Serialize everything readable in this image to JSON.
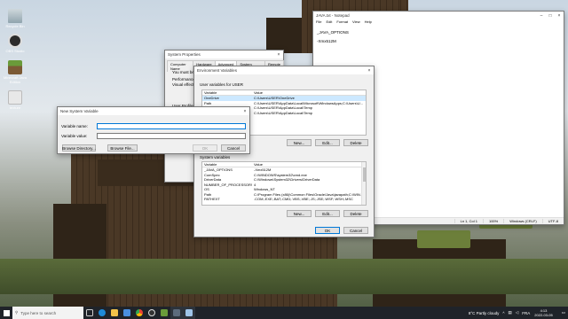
{
  "desktop": {
    "icons": [
      {
        "label": "Recycle Bin",
        "name": "recycle-bin-icon"
      },
      {
        "label": "OBS Studio",
        "name": "obs-studio-icon"
      },
      {
        "label": "Minecraft Java Edition",
        "name": "minecraft-icon"
      },
      {
        "label": "texture",
        "name": "folder-icon"
      }
    ]
  },
  "notepad": {
    "title": "JAVA.txt - Notepad",
    "menu": [
      "File",
      "Edit",
      "Format",
      "View",
      "Help"
    ],
    "lines": [
      "_JAVA_OPTIONS",
      "-Xmx512M"
    ],
    "status": {
      "position": "Ln 1, Col 1",
      "zoom": "100%",
      "eol": "Windows (CRLF)",
      "encoding": "UTF-8"
    }
  },
  "sysprops": {
    "title": "System Properties",
    "tabs": [
      "Computer Name",
      "Hardware",
      "Advanced",
      "System Protection",
      "Remote"
    ],
    "text1": "You must be lo",
    "text2": "Performance",
    "text3": "Visual effects",
    "text4": "User Profiles"
  },
  "envvars": {
    "title": "Environment Variables",
    "user_section": "User variables for USER",
    "system_section": "System variables",
    "col_variable": "Variable",
    "col_value": "Value",
    "user_rows": [
      {
        "variable": "OneDrive",
        "value": "C:\\Users\\USER\\OneDrive"
      },
      {
        "variable": "Path",
        "value": "C:\\Users\\USER\\AppData\\Local\\Microsoft\\WindowsApps;C:\\Users\\U..."
      },
      {
        "variable": "TEMP",
        "value": "C:\\Users\\USER\\AppData\\Local\\Temp"
      },
      {
        "variable": "TMP",
        "value": "C:\\Users\\USER\\AppData\\Local\\Temp"
      }
    ],
    "system_rows": [
      {
        "variable": "_JAVA_OPTIONS",
        "value": "-Xmx512M"
      },
      {
        "variable": "ComSpec",
        "value": "C:\\WINDOWS\\system32\\cmd.exe"
      },
      {
        "variable": "DriverData",
        "value": "C:\\Windows\\System32\\Drivers\\DriverData"
      },
      {
        "variable": "NUMBER_OF_PROCESSORS",
        "value": "4"
      },
      {
        "variable": "OS",
        "value": "Windows_NT"
      },
      {
        "variable": "Path",
        "value": "C:\\Program Files (x86)\\Common Files\\Oracle\\Java\\javapath;C:\\WIN..."
      },
      {
        "variable": "PATHEXT",
        "value": ".COM;.EXE;.BAT;.CMD;.VBS;.VBE;.JS;.JSE;.WSF;.WSH;.MSC"
      }
    ],
    "buttons": {
      "new": "New...",
      "edit": "Edit...",
      "delete": "Delete",
      "ok": "OK",
      "cancel": "Cancel"
    }
  },
  "newvar": {
    "title": "New System Variable",
    "name_label": "Variable name:",
    "value_label": "Variable value:",
    "name_value": "",
    "value_value": "",
    "browse_dir": "Browse Directory...",
    "browse_file": "Browse File...",
    "ok": "OK",
    "cancel": "Cancel"
  },
  "taskbar": {
    "search_placeholder": "Type here to search",
    "weather": "8°C  Partly cloudy",
    "language": "FRA",
    "time": "4:13",
    "date": "2022-03-05"
  },
  "colors": {
    "accent": "#0078d7",
    "taskbar": "#1f2329",
    "selection": "#cce8ff"
  }
}
